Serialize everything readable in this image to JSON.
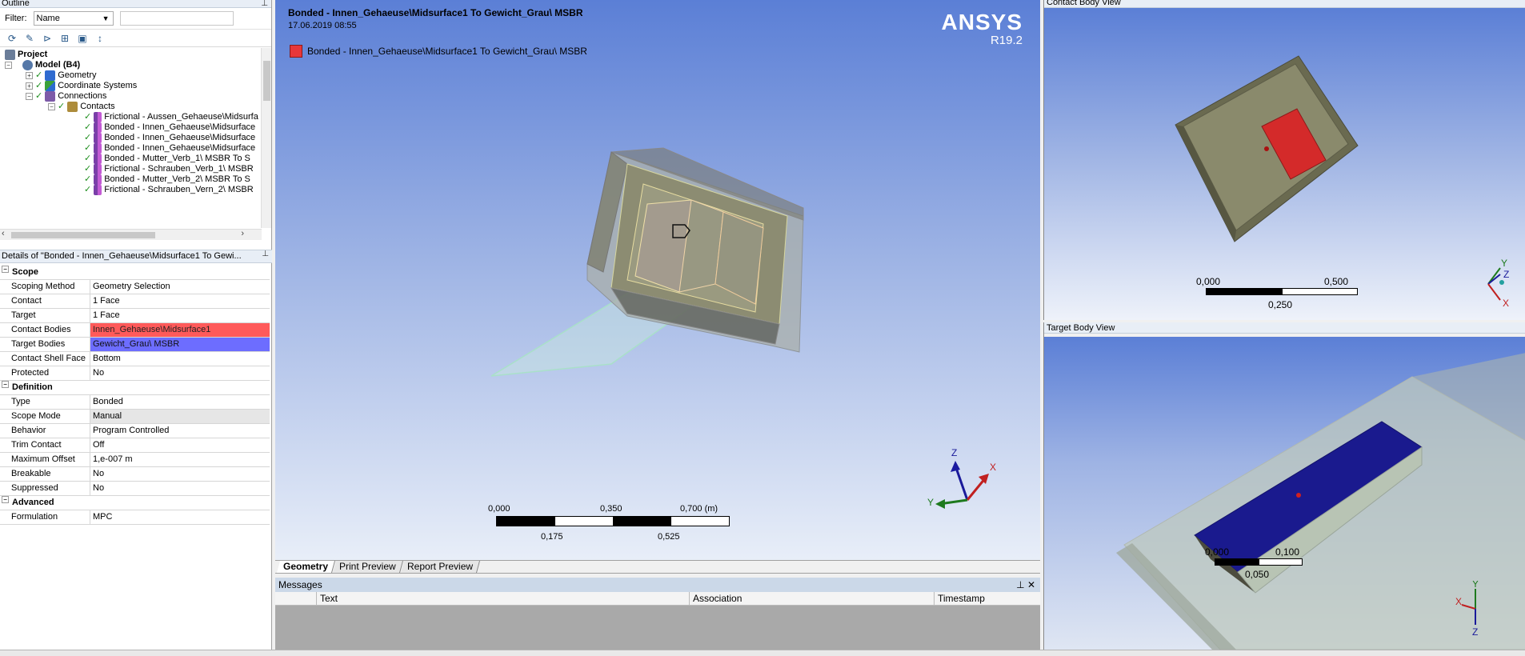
{
  "outline": {
    "title": "Outline",
    "filter_label": "Filter:",
    "filter_value": "Name",
    "tree": {
      "project": "Project",
      "model": "Model (B4)",
      "geometry": "Geometry",
      "coordinate_systems": "Coordinate Systems",
      "connections": "Connections",
      "contacts": "Contacts",
      "contact_items": [
        "Frictional - Aussen_Gehaeuse\\Midsurfa",
        "Bonded - Innen_Gehaeuse\\Midsurface",
        "Bonded - Innen_Gehaeuse\\Midsurface",
        "Bonded - Innen_Gehaeuse\\Midsurface",
        "Bonded - Mutter_Verb_1\\    MSBR To S",
        "Frictional - Schrauben_Verb_1\\    MSBR",
        "Bonded - Mutter_Verb_2\\    MSBR To S",
        "Frictional - Schrauben_Vern_2\\    MSBR"
      ]
    }
  },
  "details": {
    "title": "Details of \"Bonded - Innen_Gehaeuse\\Midsurface1 To Gewi...",
    "sections": {
      "scope": "Scope",
      "definition": "Definition",
      "advanced": "Advanced"
    },
    "scope_rows": [
      {
        "key": "Scoping Method",
        "value": "Geometry Selection"
      },
      {
        "key": "Contact",
        "value": "1 Face"
      },
      {
        "key": "Target",
        "value": "1 Face"
      },
      {
        "key": "Contact Bodies",
        "value": "Innen_Gehaeuse\\Midsurface1"
      },
      {
        "key": "Target Bodies",
        "value": "Gewicht_Grau\\    MSBR"
      },
      {
        "key": "Contact Shell Face",
        "value": "Bottom"
      },
      {
        "key": "Protected",
        "value": "No"
      }
    ],
    "definition_rows": [
      {
        "key": "Type",
        "value": "Bonded"
      },
      {
        "key": "Scope Mode",
        "value": "Manual"
      },
      {
        "key": "Behavior",
        "value": "Program Controlled"
      },
      {
        "key": "Trim Contact",
        "value": "Off"
      },
      {
        "key": "Maximum Offset",
        "value": "1,e-007 m"
      },
      {
        "key": "Breakable",
        "value": "No"
      },
      {
        "key": "Suppressed",
        "value": "No"
      }
    ],
    "advanced_rows": [
      {
        "key": "Formulation",
        "value": "MPC"
      }
    ]
  },
  "viewport": {
    "title": "Bonded - Innen_Gehaeuse\\Midsurface1 To Gewicht_Grau\\    MSBR",
    "date": "17.06.2019 08:55",
    "legend_label": "Bonded - Innen_Gehaeuse\\Midsurface1 To Gewicht_Grau\\    MSBR",
    "brand": "ANSYS",
    "version": "R19.2",
    "scale": {
      "t0": "0,000",
      "t1": "0,350",
      "t2": "0,700 (m)",
      "b1": "0,175",
      "b2": "0,525"
    },
    "triad": {
      "x": "X",
      "y": "Y",
      "z": "Z"
    }
  },
  "tabs": [
    "Geometry",
    "Print Preview",
    "Report Preview"
  ],
  "messages": {
    "title": "Messages",
    "columns": [
      "Text",
      "Association",
      "Timestamp"
    ]
  },
  "contact_view": {
    "title": "Contact Body View",
    "scale": {
      "t0": "0,000",
      "t1": "0,500",
      "b1": "0,250"
    }
  },
  "target_view": {
    "title": "Target Body View",
    "scale": {
      "t0": "0,000",
      "t1": "0,100",
      "b1": "0,050"
    }
  },
  "colors": {
    "contact_body": "#ff5a5a",
    "target_body": "#6d6dff",
    "legend_red": "#e8373a"
  }
}
